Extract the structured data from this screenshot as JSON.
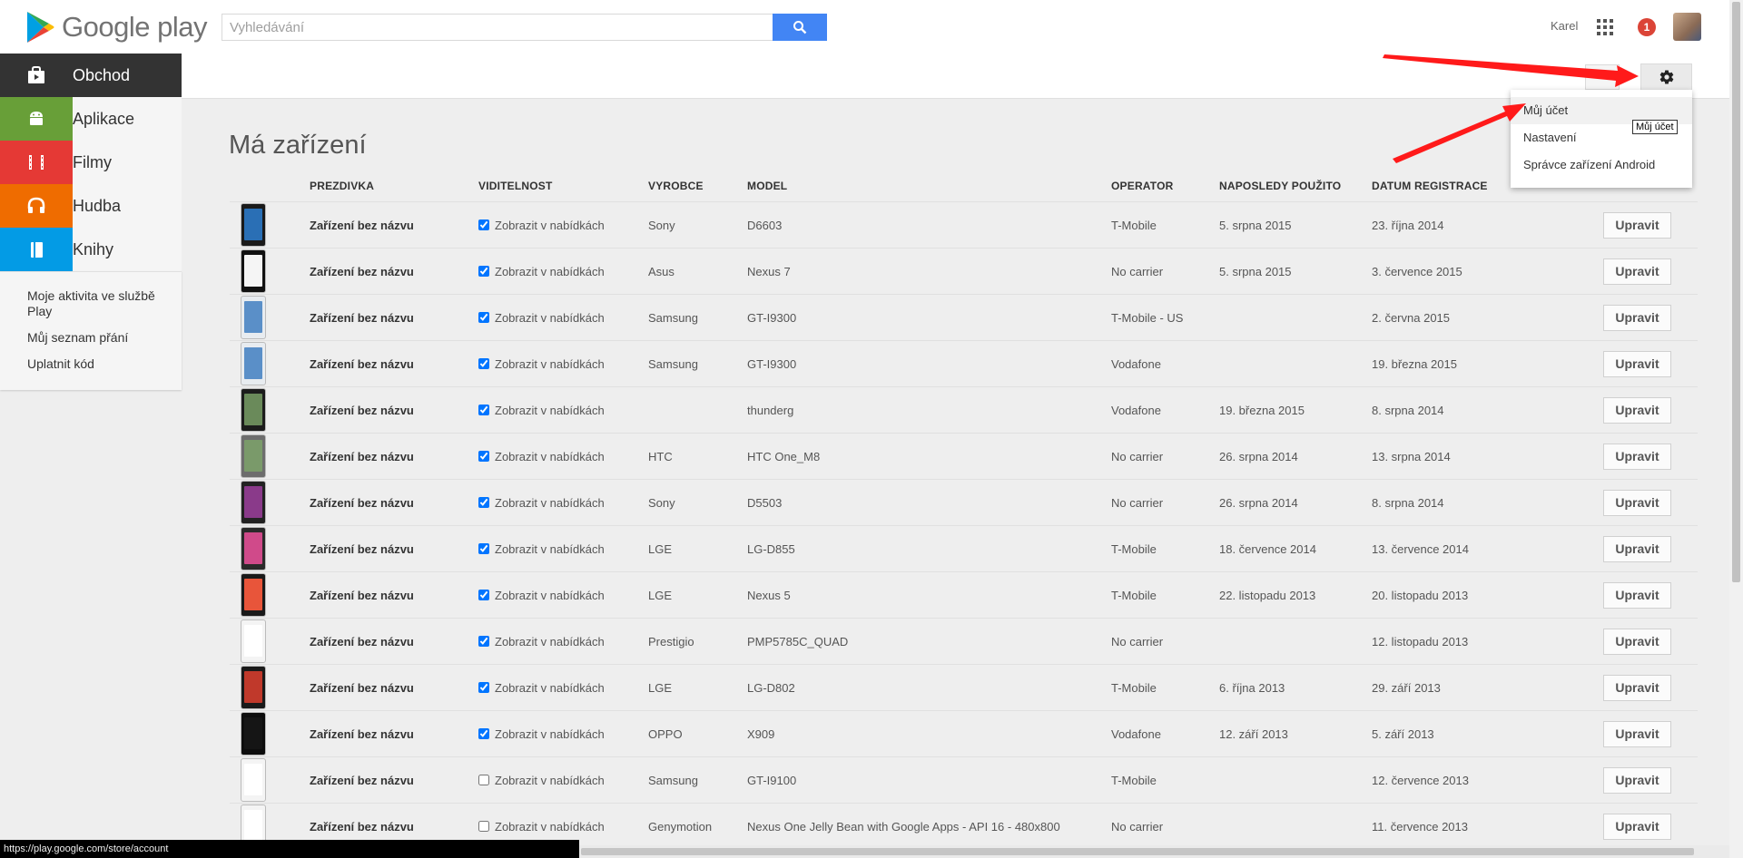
{
  "header": {
    "logo_text": "Google play",
    "search_placeholder": "Vyhledávání",
    "user_name": "Karel",
    "notification_count": "1"
  },
  "sidebar": {
    "nav": [
      {
        "label": "Obchod",
        "color": "#333333",
        "icon": "shopping-bag-icon"
      },
      {
        "label": "Aplikace",
        "color": "#689f38",
        "icon": "android-icon"
      },
      {
        "label": "Filmy",
        "color": "#e53935",
        "icon": "film-icon"
      },
      {
        "label": "Hudba",
        "color": "#ef6c00",
        "icon": "headphones-icon"
      },
      {
        "label": "Knihy",
        "color": "#039be5",
        "icon": "book-icon"
      }
    ],
    "links": [
      "Moje aktivita ve službě Play",
      "Můj seznam přání",
      "Uplatnit kód"
    ]
  },
  "dropdown": {
    "items": [
      "Můj účet",
      "Nastavení",
      "Správce zařízení Android"
    ],
    "tooltip": "Můj účet"
  },
  "page": {
    "title": "Má zařízení"
  },
  "table": {
    "headers": [
      "PREZDIVKA",
      "VIDITELNOST",
      "VYROBCE",
      "MODEL",
      "OPERATOR",
      "NAPOSLEDY POUŽITO",
      "DATUM REGISTRACE"
    ],
    "edit_label": "Upravit",
    "visibility_label": "Zobrazit v nabídkách",
    "rows": [
      {
        "name": "Zařízení bez názvu",
        "visible": true,
        "maker": "Sony",
        "model": "D6603",
        "operator": "T-Mobile",
        "last_used": "5. srpna 2015",
        "registered": "23. října 2014",
        "phone": "#1a1a1a",
        "screen": "#2a6fb5"
      },
      {
        "name": "Zařízení bez názvu",
        "visible": true,
        "maker": "Asus",
        "model": "Nexus 7",
        "operator": "No carrier",
        "last_used": "5. srpna 2015",
        "registered": "3. července 2015",
        "phone": "#111111",
        "screen": "#f5f5f5"
      },
      {
        "name": "Zařízení bez názvu",
        "visible": true,
        "maker": "Samsung",
        "model": "GT-I9300",
        "operator": "T-Mobile - US",
        "last_used": "",
        "registered": "2. června 2015",
        "phone": "#e8ecf0",
        "screen": "#5a8fc8"
      },
      {
        "name": "Zařízení bez názvu",
        "visible": true,
        "maker": "Samsung",
        "model": "GT-I9300",
        "operator": "Vodafone",
        "last_used": "",
        "registered": "19. března 2015",
        "phone": "#e8ecf0",
        "screen": "#5a8fc8"
      },
      {
        "name": "Zařízení bez názvu",
        "visible": true,
        "maker": "",
        "model": "thunderg",
        "operator": "Vodafone",
        "last_used": "19. března 2015",
        "registered": "8. srpna 2014",
        "phone": "#1c1c1c",
        "screen": "#6a8a5a"
      },
      {
        "name": "Zařízení bez názvu",
        "visible": true,
        "maker": "HTC",
        "model": "HTC One_M8",
        "operator": "No carrier",
        "last_used": "26. srpna 2014",
        "registered": "13. srpna 2014",
        "phone": "#6d6d6d",
        "screen": "#7a9a6a"
      },
      {
        "name": "Zařízení bez názvu",
        "visible": true,
        "maker": "Sony",
        "model": "D5503",
        "operator": "No carrier",
        "last_used": "26. srpna 2014",
        "registered": "8. srpna 2014",
        "phone": "#222222",
        "screen": "#8a3a8a"
      },
      {
        "name": "Zařízení bez názvu",
        "visible": true,
        "maker": "LGE",
        "model": "LG-D855",
        "operator": "T-Mobile",
        "last_used": "18. července 2014",
        "registered": "13. července 2014",
        "phone": "#2a2a2a",
        "screen": "#d04a8a"
      },
      {
        "name": "Zařízení bez názvu",
        "visible": true,
        "maker": "LGE",
        "model": "Nexus 5",
        "operator": "T-Mobile",
        "last_used": "22. listopadu 2013",
        "registered": "20. listopadu 2013",
        "phone": "#1a1a1a",
        "screen": "#e8553a"
      },
      {
        "name": "Zařízení bez názvu",
        "visible": true,
        "maker": "Prestigio",
        "model": "PMP5785C_QUAD",
        "operator": "No carrier",
        "last_used": "",
        "registered": "12. listopadu 2013",
        "phone": "#f4f4f4",
        "screen": "#ffffff"
      },
      {
        "name": "Zařízení bez názvu",
        "visible": true,
        "maker": "LGE",
        "model": "LG-D802",
        "operator": "T-Mobile",
        "last_used": "6. října 2013",
        "registered": "29. září 2013",
        "phone": "#1a1a1a",
        "screen": "#c0392b"
      },
      {
        "name": "Zařízení bez názvu",
        "visible": true,
        "maker": "OPPO",
        "model": "X909",
        "operator": "Vodafone",
        "last_used": "12. září 2013",
        "registered": "5. září 2013",
        "phone": "#0d0d0d",
        "screen": "#151515"
      },
      {
        "name": "Zařízení bez názvu",
        "visible": false,
        "maker": "Samsung",
        "model": "GT-I9100",
        "operator": "T-Mobile",
        "last_used": "",
        "registered": "12. července 2013",
        "phone": "#f4f4f4",
        "screen": "#ffffff"
      },
      {
        "name": "Zařízení bez názvu",
        "visible": false,
        "maker": "Genymotion",
        "model": "Nexus One Jelly Bean with Google Apps - API 16 - 480x800",
        "operator": "No carrier",
        "last_used": "",
        "registered": "11. července 2013",
        "phone": "#f4f4f4",
        "screen": "#ffffff"
      }
    ]
  },
  "statusbar": {
    "url": "https://play.google.com/store/account"
  }
}
